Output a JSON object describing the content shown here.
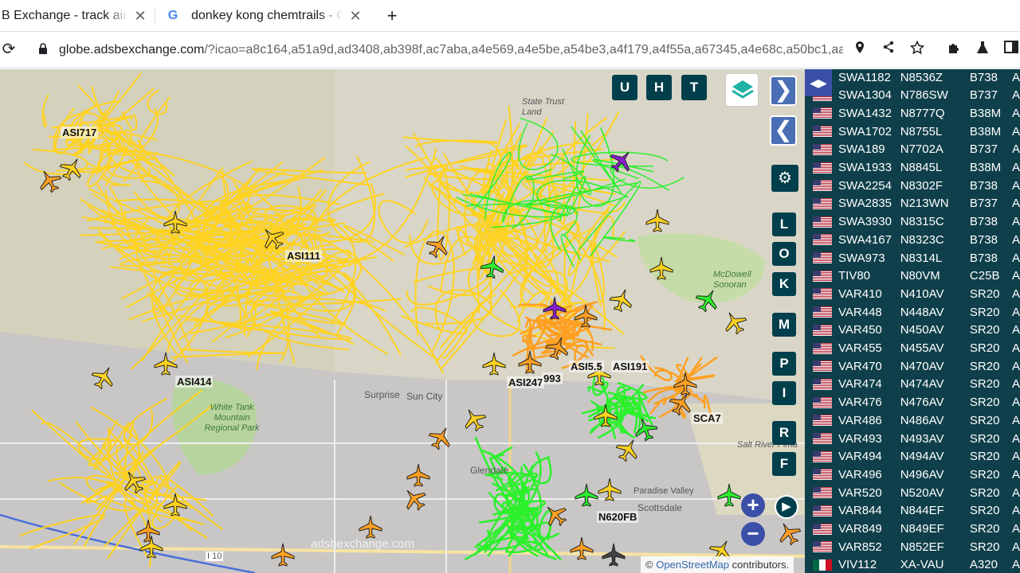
{
  "tabs": [
    {
      "title": "B Exchange - track aircraft",
      "close": "✕",
      "active": false
    },
    {
      "title": "donkey kong chemtrails - Google Search",
      "close": "✕",
      "active": true
    }
  ],
  "new_tab": "+",
  "toolbar": {
    "reload": "⟳",
    "url_host": "globe.adsbexchange.com",
    "url_path": "/?icao=a8c164,a51a9d,ad3408,ab398f,ac7aba,a4e569,a4e5be,a54be3,a4f179,a4f55a,a67345,a4e68c,a50bc1,aa..."
  },
  "map": {
    "top_buttons": [
      "U",
      "H",
      "T"
    ],
    "side_buttons": [
      "L",
      "O",
      "K",
      "M",
      "P",
      "I",
      "R",
      "F"
    ],
    "nav_next": "❯",
    "nav_prev": "❮",
    "gear": "⚙",
    "zoom_in": "+",
    "zoom_out": "−",
    "replay": "▶",
    "watermark": "adsbexchange.com",
    "attribution_prefix": "©",
    "attribution_link": "OpenStreetMap",
    "attribution_suffix": "contributors.",
    "places": {
      "surprise": "Surprise",
      "sun_city": "Sun City",
      "glendale": "Glendale",
      "scottsdale": "Scottsdale",
      "state_trust": "State Trust Land",
      "mcdowell": "McDowell Sonoran",
      "salt_river": "Salt River Pima",
      "paradise_valley": "Paradise Valley",
      "i10": "I 10"
    },
    "park": "White Tank Mountain Regional Park",
    "aircraft_labels": {
      "asi717": "ASI717",
      "asi111": "ASI111",
      "asi414": "ASI414",
      "asi247": "ASI247",
      "asi15": "ASI5.5",
      "asi191": "ASI191",
      "n993": "993",
      "sca7": "SCA7",
      "n620fb": "N620FB"
    }
  },
  "aircraft_list": {
    "toggle": "◀▶",
    "rows": [
      {
        "callsign": "SWA1182",
        "reg": "N8536Z",
        "type": "B738",
        "more": "A",
        "country": "us"
      },
      {
        "callsign": "SWA1304",
        "reg": "N786SW",
        "type": "B737",
        "more": "A",
        "country": "us"
      },
      {
        "callsign": "SWA1432",
        "reg": "N8777Q",
        "type": "B38M",
        "more": "A",
        "country": "us"
      },
      {
        "callsign": "SWA1702",
        "reg": "N8755L",
        "type": "B38M",
        "more": "A",
        "country": "us"
      },
      {
        "callsign": "SWA189",
        "reg": "N7702A",
        "type": "B737",
        "more": "A",
        "country": "us"
      },
      {
        "callsign": "SWA1933",
        "reg": "N8845L",
        "type": "B38M",
        "more": "A",
        "country": "us"
      },
      {
        "callsign": "SWA2254",
        "reg": "N8302F",
        "type": "B738",
        "more": "A",
        "country": "us"
      },
      {
        "callsign": "SWA2835",
        "reg": "N213WN",
        "type": "B737",
        "more": "A",
        "country": "us"
      },
      {
        "callsign": "SWA3930",
        "reg": "N8315C",
        "type": "B738",
        "more": "A",
        "country": "us"
      },
      {
        "callsign": "SWA4167",
        "reg": "N8323C",
        "type": "B738",
        "more": "A",
        "country": "us"
      },
      {
        "callsign": "SWA973",
        "reg": "N8314L",
        "type": "B738",
        "more": "A",
        "country": "us"
      },
      {
        "callsign": "TIV80",
        "reg": "N80VM",
        "type": "C25B",
        "more": "A",
        "country": "us"
      },
      {
        "callsign": "VAR410",
        "reg": "N410AV",
        "type": "SR20",
        "more": "A",
        "country": "us"
      },
      {
        "callsign": "VAR448",
        "reg": "N448AV",
        "type": "SR20",
        "more": "A",
        "country": "us"
      },
      {
        "callsign": "VAR450",
        "reg": "N450AV",
        "type": "SR20",
        "more": "A",
        "country": "us"
      },
      {
        "callsign": "VAR455",
        "reg": "N455AV",
        "type": "SR20",
        "more": "A",
        "country": "us"
      },
      {
        "callsign": "VAR470",
        "reg": "N470AV",
        "type": "SR20",
        "more": "A",
        "country": "us"
      },
      {
        "callsign": "VAR474",
        "reg": "N474AV",
        "type": "SR20",
        "more": "A",
        "country": "us"
      },
      {
        "callsign": "VAR476",
        "reg": "N476AV",
        "type": "SR20",
        "more": "A",
        "country": "us"
      },
      {
        "callsign": "VAR486",
        "reg": "N486AV",
        "type": "SR20",
        "more": "A",
        "country": "us"
      },
      {
        "callsign": "VAR493",
        "reg": "N493AV",
        "type": "SR20",
        "more": "A",
        "country": "us"
      },
      {
        "callsign": "VAR494",
        "reg": "N494AV",
        "type": "SR20",
        "more": "A",
        "country": "us"
      },
      {
        "callsign": "VAR496",
        "reg": "N496AV",
        "type": "SR20",
        "more": "A",
        "country": "us"
      },
      {
        "callsign": "VAR520",
        "reg": "N520AV",
        "type": "SR20",
        "more": "A",
        "country": "us"
      },
      {
        "callsign": "VAR844",
        "reg": "N844EF",
        "type": "SR20",
        "more": "A",
        "country": "us"
      },
      {
        "callsign": "VAR849",
        "reg": "N849EF",
        "type": "SR20",
        "more": "A",
        "country": "us"
      },
      {
        "callsign": "VAR852",
        "reg": "N852EF",
        "type": "SR20",
        "more": "A",
        "country": "us"
      },
      {
        "callsign": "VIV112",
        "reg": "XA-VAU",
        "type": "A320",
        "more": "A",
        "country": "mx"
      }
    ]
  },
  "colors": {
    "panel_bg": "#0f3f4a",
    "button_bg": "#003f4b",
    "nav_blue": "#4b6fb4",
    "track_yellow": "#ffd21f",
    "track_orange": "#ffa022",
    "track_green": "#2cf02c"
  }
}
